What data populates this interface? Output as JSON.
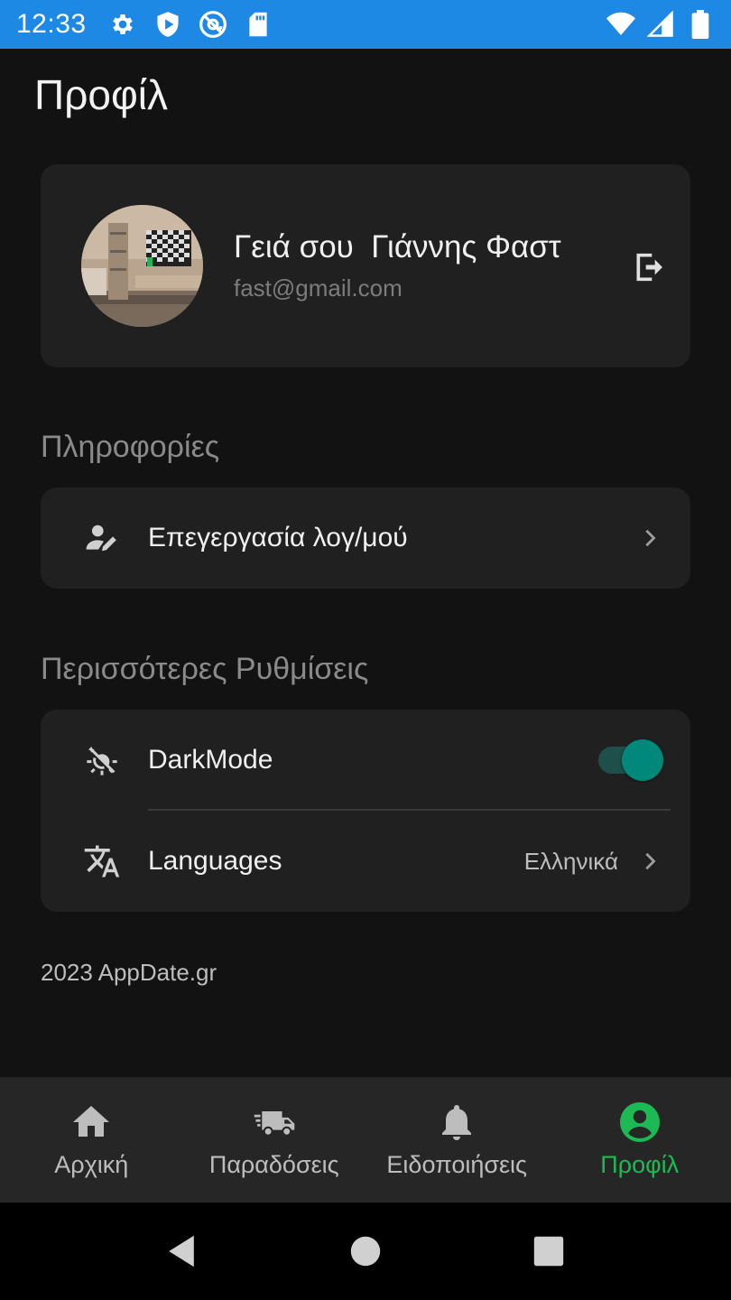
{
  "status_bar": {
    "time": "12:33",
    "left_icons": [
      "settings-icon",
      "shield-play-icon",
      "at-sign-icon",
      "sd-card-icon"
    ],
    "right_icons": [
      "wifi-icon",
      "signal-icon",
      "battery-icon"
    ],
    "color": "#1e88e5"
  },
  "page": {
    "title": "Προφίλ"
  },
  "profile": {
    "greeting": "Γειά σου  Γιάννης Φαστ",
    "email": "fast@gmail.com"
  },
  "sections": {
    "info_title": "Πληροφορίες",
    "more_title": "Περισσότερες Ρυθμίσεις"
  },
  "info_items": [
    {
      "label": "Επεγεργασία λογ/μού",
      "icon": "edit-user-icon"
    }
  ],
  "settings": {
    "dark_mode": {
      "label": "DarkMode",
      "icon": "theme-icon",
      "enabled": true
    },
    "languages": {
      "label": "Languages",
      "icon": "translate-icon",
      "value": "Ελληνικά"
    }
  },
  "footer": {
    "text": "2023 AppDate.gr"
  },
  "bottom_nav": [
    {
      "label": "Αρχική",
      "icon": "home-icon",
      "active": false
    },
    {
      "label": "Παραδόσεις",
      "icon": "truck-icon",
      "active": false
    },
    {
      "label": "Ειδοποιήσεις",
      "icon": "bell-icon",
      "active": false
    },
    {
      "label": "Προφίλ",
      "icon": "account-circle-icon",
      "active": true
    }
  ],
  "colors": {
    "accent": "#1db954",
    "toggle": "#00897b",
    "card": "#202020",
    "background": "#121212"
  }
}
